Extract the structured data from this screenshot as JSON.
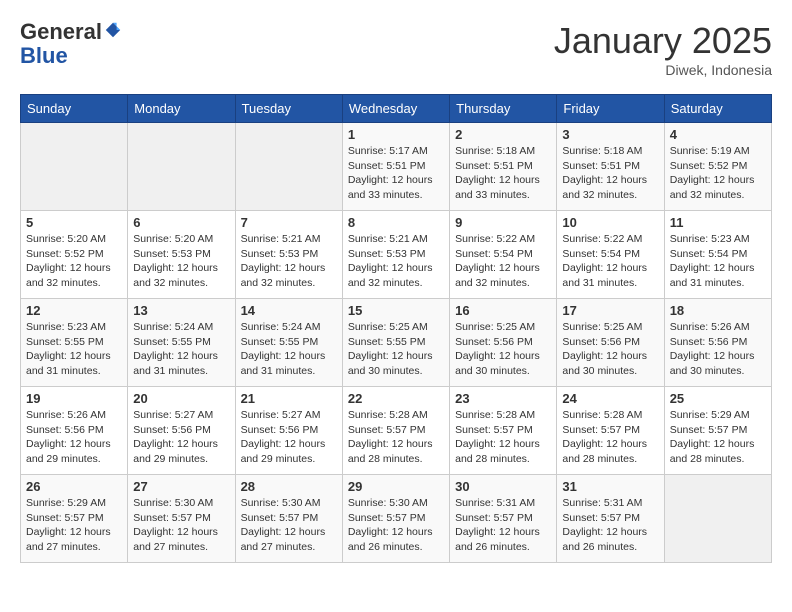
{
  "header": {
    "logo_general": "General",
    "logo_blue": "Blue",
    "month_title": "January 2025",
    "location": "Diwek, Indonesia"
  },
  "days_of_week": [
    "Sunday",
    "Monday",
    "Tuesday",
    "Wednesday",
    "Thursday",
    "Friday",
    "Saturday"
  ],
  "weeks": [
    {
      "days": [
        {
          "number": "",
          "empty": true
        },
        {
          "number": "",
          "empty": true
        },
        {
          "number": "",
          "empty": true
        },
        {
          "number": "1",
          "sunrise": "5:17 AM",
          "sunset": "5:51 PM",
          "daylight": "12 hours and 33 minutes."
        },
        {
          "number": "2",
          "sunrise": "5:18 AM",
          "sunset": "5:51 PM",
          "daylight": "12 hours and 33 minutes."
        },
        {
          "number": "3",
          "sunrise": "5:18 AM",
          "sunset": "5:51 PM",
          "daylight": "12 hours and 32 minutes."
        },
        {
          "number": "4",
          "sunrise": "5:19 AM",
          "sunset": "5:52 PM",
          "daylight": "12 hours and 32 minutes."
        }
      ]
    },
    {
      "days": [
        {
          "number": "5",
          "sunrise": "5:20 AM",
          "sunset": "5:52 PM",
          "daylight": "12 hours and 32 minutes."
        },
        {
          "number": "6",
          "sunrise": "5:20 AM",
          "sunset": "5:53 PM",
          "daylight": "12 hours and 32 minutes."
        },
        {
          "number": "7",
          "sunrise": "5:21 AM",
          "sunset": "5:53 PM",
          "daylight": "12 hours and 32 minutes."
        },
        {
          "number": "8",
          "sunrise": "5:21 AM",
          "sunset": "5:53 PM",
          "daylight": "12 hours and 32 minutes."
        },
        {
          "number": "9",
          "sunrise": "5:22 AM",
          "sunset": "5:54 PM",
          "daylight": "12 hours and 32 minutes."
        },
        {
          "number": "10",
          "sunrise": "5:22 AM",
          "sunset": "5:54 PM",
          "daylight": "12 hours and 31 minutes."
        },
        {
          "number": "11",
          "sunrise": "5:23 AM",
          "sunset": "5:54 PM",
          "daylight": "12 hours and 31 minutes."
        }
      ]
    },
    {
      "days": [
        {
          "number": "12",
          "sunrise": "5:23 AM",
          "sunset": "5:55 PM",
          "daylight": "12 hours and 31 minutes."
        },
        {
          "number": "13",
          "sunrise": "5:24 AM",
          "sunset": "5:55 PM",
          "daylight": "12 hours and 31 minutes."
        },
        {
          "number": "14",
          "sunrise": "5:24 AM",
          "sunset": "5:55 PM",
          "daylight": "12 hours and 31 minutes."
        },
        {
          "number": "15",
          "sunrise": "5:25 AM",
          "sunset": "5:55 PM",
          "daylight": "12 hours and 30 minutes."
        },
        {
          "number": "16",
          "sunrise": "5:25 AM",
          "sunset": "5:56 PM",
          "daylight": "12 hours and 30 minutes."
        },
        {
          "number": "17",
          "sunrise": "5:25 AM",
          "sunset": "5:56 PM",
          "daylight": "12 hours and 30 minutes."
        },
        {
          "number": "18",
          "sunrise": "5:26 AM",
          "sunset": "5:56 PM",
          "daylight": "12 hours and 30 minutes."
        }
      ]
    },
    {
      "days": [
        {
          "number": "19",
          "sunrise": "5:26 AM",
          "sunset": "5:56 PM",
          "daylight": "12 hours and 29 minutes."
        },
        {
          "number": "20",
          "sunrise": "5:27 AM",
          "sunset": "5:56 PM",
          "daylight": "12 hours and 29 minutes."
        },
        {
          "number": "21",
          "sunrise": "5:27 AM",
          "sunset": "5:56 PM",
          "daylight": "12 hours and 29 minutes."
        },
        {
          "number": "22",
          "sunrise": "5:28 AM",
          "sunset": "5:57 PM",
          "daylight": "12 hours and 28 minutes."
        },
        {
          "number": "23",
          "sunrise": "5:28 AM",
          "sunset": "5:57 PM",
          "daylight": "12 hours and 28 minutes."
        },
        {
          "number": "24",
          "sunrise": "5:28 AM",
          "sunset": "5:57 PM",
          "daylight": "12 hours and 28 minutes."
        },
        {
          "number": "25",
          "sunrise": "5:29 AM",
          "sunset": "5:57 PM",
          "daylight": "12 hours and 28 minutes."
        }
      ]
    },
    {
      "days": [
        {
          "number": "26",
          "sunrise": "5:29 AM",
          "sunset": "5:57 PM",
          "daylight": "12 hours and 27 minutes."
        },
        {
          "number": "27",
          "sunrise": "5:30 AM",
          "sunset": "5:57 PM",
          "daylight": "12 hours and 27 minutes."
        },
        {
          "number": "28",
          "sunrise": "5:30 AM",
          "sunset": "5:57 PM",
          "daylight": "12 hours and 27 minutes."
        },
        {
          "number": "29",
          "sunrise": "5:30 AM",
          "sunset": "5:57 PM",
          "daylight": "12 hours and 26 minutes."
        },
        {
          "number": "30",
          "sunrise": "5:31 AM",
          "sunset": "5:57 PM",
          "daylight": "12 hours and 26 minutes."
        },
        {
          "number": "31",
          "sunrise": "5:31 AM",
          "sunset": "5:57 PM",
          "daylight": "12 hours and 26 minutes."
        },
        {
          "number": "",
          "empty": true
        }
      ]
    }
  ]
}
